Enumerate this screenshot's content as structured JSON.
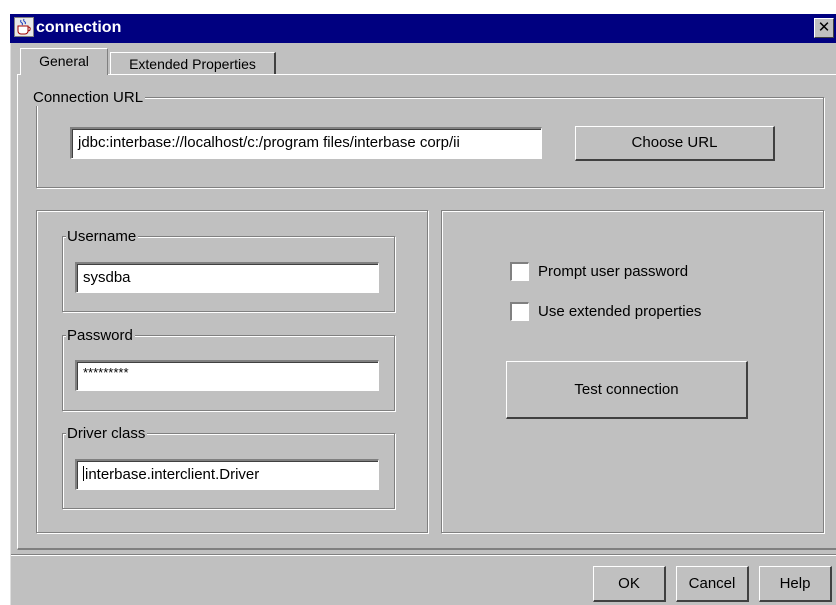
{
  "window": {
    "title": "connection",
    "close_glyph": "✕",
    "icon": "java-cup-icon"
  },
  "tabs": [
    {
      "label": "General",
      "selected": true
    },
    {
      "label": "Extended Properties",
      "selected": false
    }
  ],
  "connection_url": {
    "legend": "Connection URL",
    "value": "jdbc:interbase://localhost/c:/program files/interbase corp/ii",
    "choose_button": "Choose URL"
  },
  "credentials": {
    "username_legend": "Username",
    "username_value": "sysdba",
    "password_legend": "Password",
    "password_value": "*********",
    "driver_legend": "Driver class",
    "driver_value": "interbase.interclient.Driver"
  },
  "options": {
    "prompt_password_label": "Prompt user password",
    "prompt_password_checked": false,
    "extended_props_label": "Use extended properties",
    "extended_props_checked": false,
    "test_button": "Test connection"
  },
  "footer": {
    "ok": "OK",
    "cancel": "Cancel",
    "help": "Help"
  },
  "colors": {
    "titlebar": "#000080",
    "face": "#c0c0c0"
  }
}
